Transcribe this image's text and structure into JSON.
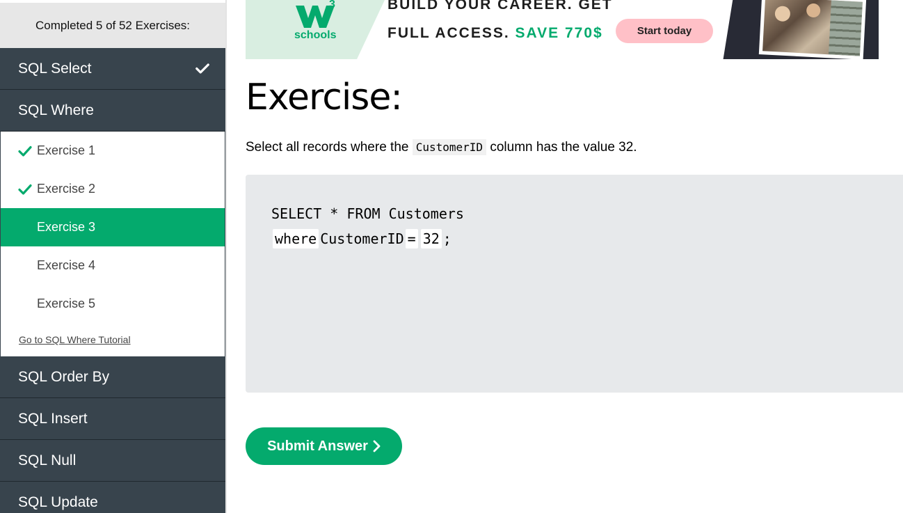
{
  "sidebar": {
    "progress_text": "Completed 5 of 52 Exercises:",
    "topics_before": [
      {
        "label": "SQL Select",
        "completed": true
      },
      {
        "label": "SQL Where",
        "completed": false
      }
    ],
    "exercises": [
      {
        "label": "Exercise 1",
        "completed": true,
        "active": false
      },
      {
        "label": "Exercise 2",
        "completed": true,
        "active": false
      },
      {
        "label": "Exercise 3",
        "completed": false,
        "active": true
      },
      {
        "label": "Exercise 4",
        "completed": false,
        "active": false
      },
      {
        "label": "Exercise 5",
        "completed": false,
        "active": false
      }
    ],
    "tutorial_link": "Go to SQL Where Tutorial",
    "topics_after": [
      {
        "label": "SQL Order By"
      },
      {
        "label": "SQL Insert"
      },
      {
        "label": "SQL Null"
      },
      {
        "label": "SQL Update"
      }
    ]
  },
  "banner": {
    "logo_sup": "3",
    "logo_text": "schools",
    "headline_1": "BUILD YOUR CAREER. GET",
    "headline_2_prefix": "FULL ACCESS.",
    "headline_2_highlight": "SAVE 770$",
    "cta_label": "Start today"
  },
  "exercise": {
    "title": "Exercise:",
    "instruction_prefix": "Select all records where the",
    "instruction_code": "CustomerID",
    "instruction_suffix": "column has the value 32.",
    "code_line_1": "SELECT * FROM Customers",
    "blank_1": "where",
    "code_mid": "CustomerID",
    "blank_2": "=",
    "blank_3": "32",
    "code_end": ";"
  },
  "submit_label": "Submit Answer",
  "colors": {
    "accent_green": "#04aa6d",
    "sidebar_dark": "#38444d",
    "editor_bg": "#e7e9eb",
    "cta_pink": "#ffc0c7"
  }
}
